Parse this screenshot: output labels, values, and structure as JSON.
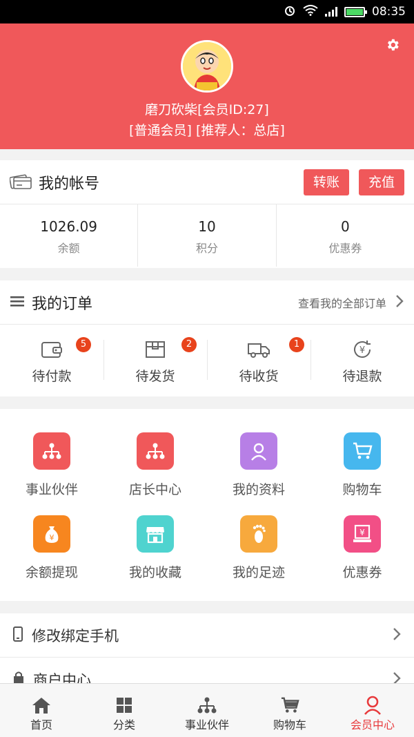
{
  "status_bar": {
    "time": "08:35"
  },
  "profile": {
    "name_line": "磨刀砍柴[会员ID:27]",
    "role_line": "[普通会员] [推荐人：总店]"
  },
  "account": {
    "title": "我的帐号",
    "transfer_label": "转账",
    "recharge_label": "充值",
    "stats": [
      {
        "value": "1026.09",
        "label": "余额"
      },
      {
        "value": "10",
        "label": "积分"
      },
      {
        "value": "0",
        "label": "优惠券"
      }
    ]
  },
  "orders": {
    "title": "我的订单",
    "view_all": "查看我的全部订单",
    "items": [
      {
        "label": "待付款",
        "badge": "5",
        "icon": "wallet-icon"
      },
      {
        "label": "待发货",
        "badge": "2",
        "icon": "package-icon"
      },
      {
        "label": "待收货",
        "badge": "1",
        "icon": "truck-icon"
      },
      {
        "label": "待退款",
        "icon": "refund-icon"
      }
    ]
  },
  "features": [
    {
      "label": "事业伙伴",
      "icon": "network-icon",
      "color": "#f0585a"
    },
    {
      "label": "店长中心",
      "icon": "network-icon",
      "color": "#f0585a"
    },
    {
      "label": "我的资料",
      "icon": "user-icon",
      "color": "#b77fe6"
    },
    {
      "label": "购物车",
      "icon": "cart-icon",
      "color": "#46b7ee"
    },
    {
      "label": "余额提现",
      "icon": "moneybag-icon",
      "color": "#f7861f"
    },
    {
      "label": "我的收藏",
      "icon": "store-icon",
      "color": "#4fd3cf"
    },
    {
      "label": "我的足迹",
      "icon": "footprint-icon",
      "color": "#f7a93d"
    },
    {
      "label": "优惠券",
      "icon": "coupon-icon",
      "color": "#f24f86"
    }
  ],
  "menu": [
    {
      "label": "修改绑定手机",
      "icon": "phone-icon"
    },
    {
      "label": "商户中心",
      "icon": "shop-icon"
    }
  ],
  "tabbar": [
    {
      "label": "首页",
      "icon": "home-icon"
    },
    {
      "label": "分类",
      "icon": "grid-icon"
    },
    {
      "label": "事业伙伴",
      "icon": "network-icon"
    },
    {
      "label": "购物车",
      "icon": "cart-icon"
    },
    {
      "label": "会员中心",
      "icon": "user-icon",
      "active": true
    }
  ],
  "colors": {
    "brand": "#f0585a",
    "badge": "#e8431c",
    "active_tab": "#e83a3c"
  }
}
